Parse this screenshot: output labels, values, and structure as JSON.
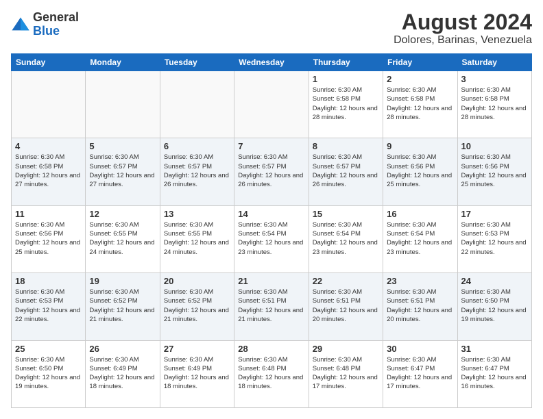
{
  "logo": {
    "general": "General",
    "blue": "Blue"
  },
  "header": {
    "month_year": "August 2024",
    "location": "Dolores, Barinas, Venezuela"
  },
  "weekdays": [
    "Sunday",
    "Monday",
    "Tuesday",
    "Wednesday",
    "Thursday",
    "Friday",
    "Saturday"
  ],
  "weeks": [
    [
      {
        "day": "",
        "info": ""
      },
      {
        "day": "",
        "info": ""
      },
      {
        "day": "",
        "info": ""
      },
      {
        "day": "",
        "info": ""
      },
      {
        "day": "1",
        "info": "Sunrise: 6:30 AM\nSunset: 6:58 PM\nDaylight: 12 hours\nand 28 minutes."
      },
      {
        "day": "2",
        "info": "Sunrise: 6:30 AM\nSunset: 6:58 PM\nDaylight: 12 hours\nand 28 minutes."
      },
      {
        "day": "3",
        "info": "Sunrise: 6:30 AM\nSunset: 6:58 PM\nDaylight: 12 hours\nand 28 minutes."
      }
    ],
    [
      {
        "day": "4",
        "info": "Sunrise: 6:30 AM\nSunset: 6:58 PM\nDaylight: 12 hours\nand 27 minutes."
      },
      {
        "day": "5",
        "info": "Sunrise: 6:30 AM\nSunset: 6:57 PM\nDaylight: 12 hours\nand 27 minutes."
      },
      {
        "day": "6",
        "info": "Sunrise: 6:30 AM\nSunset: 6:57 PM\nDaylight: 12 hours\nand 26 minutes."
      },
      {
        "day": "7",
        "info": "Sunrise: 6:30 AM\nSunset: 6:57 PM\nDaylight: 12 hours\nand 26 minutes."
      },
      {
        "day": "8",
        "info": "Sunrise: 6:30 AM\nSunset: 6:57 PM\nDaylight: 12 hours\nand 26 minutes."
      },
      {
        "day": "9",
        "info": "Sunrise: 6:30 AM\nSunset: 6:56 PM\nDaylight: 12 hours\nand 25 minutes."
      },
      {
        "day": "10",
        "info": "Sunrise: 6:30 AM\nSunset: 6:56 PM\nDaylight: 12 hours\nand 25 minutes."
      }
    ],
    [
      {
        "day": "11",
        "info": "Sunrise: 6:30 AM\nSunset: 6:56 PM\nDaylight: 12 hours\nand 25 minutes."
      },
      {
        "day": "12",
        "info": "Sunrise: 6:30 AM\nSunset: 6:55 PM\nDaylight: 12 hours\nand 24 minutes."
      },
      {
        "day": "13",
        "info": "Sunrise: 6:30 AM\nSunset: 6:55 PM\nDaylight: 12 hours\nand 24 minutes."
      },
      {
        "day": "14",
        "info": "Sunrise: 6:30 AM\nSunset: 6:54 PM\nDaylight: 12 hours\nand 23 minutes."
      },
      {
        "day": "15",
        "info": "Sunrise: 6:30 AM\nSunset: 6:54 PM\nDaylight: 12 hours\nand 23 minutes."
      },
      {
        "day": "16",
        "info": "Sunrise: 6:30 AM\nSunset: 6:54 PM\nDaylight: 12 hours\nand 23 minutes."
      },
      {
        "day": "17",
        "info": "Sunrise: 6:30 AM\nSunset: 6:53 PM\nDaylight: 12 hours\nand 22 minutes."
      }
    ],
    [
      {
        "day": "18",
        "info": "Sunrise: 6:30 AM\nSunset: 6:53 PM\nDaylight: 12 hours\nand 22 minutes."
      },
      {
        "day": "19",
        "info": "Sunrise: 6:30 AM\nSunset: 6:52 PM\nDaylight: 12 hours\nand 21 minutes."
      },
      {
        "day": "20",
        "info": "Sunrise: 6:30 AM\nSunset: 6:52 PM\nDaylight: 12 hours\nand 21 minutes."
      },
      {
        "day": "21",
        "info": "Sunrise: 6:30 AM\nSunset: 6:51 PM\nDaylight: 12 hours\nand 21 minutes."
      },
      {
        "day": "22",
        "info": "Sunrise: 6:30 AM\nSunset: 6:51 PM\nDaylight: 12 hours\nand 20 minutes."
      },
      {
        "day": "23",
        "info": "Sunrise: 6:30 AM\nSunset: 6:51 PM\nDaylight: 12 hours\nand 20 minutes."
      },
      {
        "day": "24",
        "info": "Sunrise: 6:30 AM\nSunset: 6:50 PM\nDaylight: 12 hours\nand 19 minutes."
      }
    ],
    [
      {
        "day": "25",
        "info": "Sunrise: 6:30 AM\nSunset: 6:50 PM\nDaylight: 12 hours\nand 19 minutes."
      },
      {
        "day": "26",
        "info": "Sunrise: 6:30 AM\nSunset: 6:49 PM\nDaylight: 12 hours\nand 18 minutes."
      },
      {
        "day": "27",
        "info": "Sunrise: 6:30 AM\nSunset: 6:49 PM\nDaylight: 12 hours\nand 18 minutes."
      },
      {
        "day": "28",
        "info": "Sunrise: 6:30 AM\nSunset: 6:48 PM\nDaylight: 12 hours\nand 18 minutes."
      },
      {
        "day": "29",
        "info": "Sunrise: 6:30 AM\nSunset: 6:48 PM\nDaylight: 12 hours\nand 17 minutes."
      },
      {
        "day": "30",
        "info": "Sunrise: 6:30 AM\nSunset: 6:47 PM\nDaylight: 12 hours\nand 17 minutes."
      },
      {
        "day": "31",
        "info": "Sunrise: 6:30 AM\nSunset: 6:47 PM\nDaylight: 12 hours\nand 16 minutes."
      }
    ]
  ]
}
